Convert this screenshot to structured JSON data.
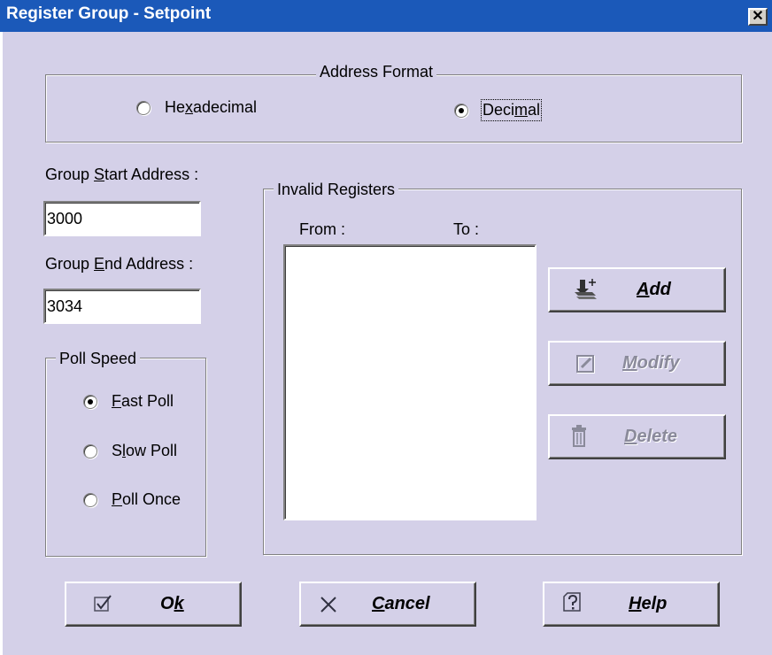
{
  "window": {
    "title": "Register Group - Setpoint",
    "close_glyph": "✕"
  },
  "address_format": {
    "legend": "Address Format",
    "options": [
      {
        "pre": "He",
        "key": "x",
        "post": "adecimal",
        "checked": false
      },
      {
        "pre": "Deci",
        "key": "m",
        "post": "al",
        "checked": true
      }
    ]
  },
  "start_address": {
    "pre": "Group ",
    "key": "S",
    "post": "tart Address :",
    "value": "3000"
  },
  "end_address": {
    "pre": "Group ",
    "key": "E",
    "post": "nd Address :",
    "value": "3034"
  },
  "poll_speed": {
    "legend": "Poll Speed",
    "options": [
      {
        "pre": "",
        "key": "F",
        "post": "ast Poll",
        "checked": true
      },
      {
        "pre": "S",
        "key": "l",
        "post": "ow Poll",
        "checked": false
      },
      {
        "pre": "",
        "key": "P",
        "post": "oll Once",
        "checked": false
      }
    ]
  },
  "invalid_registers": {
    "legend": "Invalid Registers",
    "col_from": "From :",
    "col_to": "To :",
    "rows": []
  },
  "buttons": {
    "add": {
      "key": "A",
      "post": "dd",
      "icon": "add-icon",
      "enabled": true
    },
    "modify": {
      "key": "M",
      "post": "odify",
      "icon": "edit-icon",
      "enabled": false
    },
    "delete": {
      "key": "D",
      "post": "elete",
      "icon": "trash-icon",
      "enabled": false
    },
    "ok": {
      "pre": "O",
      "key": "k",
      "post": "",
      "icon": "checkmark-icon",
      "enabled": true
    },
    "cancel": {
      "pre": "",
      "key": "C",
      "post": "ancel",
      "icon": "close-icon",
      "enabled": true
    },
    "help": {
      "pre": "",
      "key": "H",
      "post": "elp",
      "icon": "help-icon",
      "enabled": true
    }
  },
  "colors": {
    "titlebar": "#1b59b9",
    "dialog_bg": "#d4d0e8",
    "disabled_text": "#8a8a9a"
  }
}
